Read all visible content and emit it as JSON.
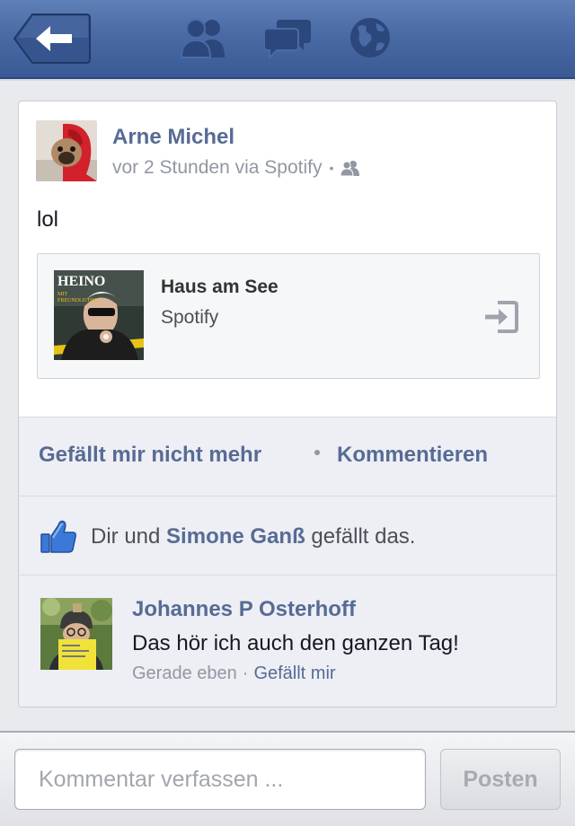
{
  "nav": {
    "icons": [
      "back-arrow-icon",
      "friends-icon",
      "messages-icon",
      "globe-icon"
    ]
  },
  "post": {
    "author": "Arne Michel",
    "time": "vor 2 Stunden via Spotify",
    "separator": "•",
    "audience_icon": "friends-audience-icon",
    "text": "lol",
    "attachment": {
      "title": "Haus am See",
      "source": "Spotify",
      "album_art_text": "HEINO",
      "open_icon": "open-external-icon"
    }
  },
  "actions": {
    "unlike_label": "Gefällt mir nicht mehr",
    "comment_label": "Kommentieren"
  },
  "likes": {
    "prefix": "Dir und ",
    "name": "Simone Ganß",
    "suffix": " gefällt das."
  },
  "comment": {
    "author": "Johannes P Osterhoff",
    "text": "Das hör ich auch den ganzen Tag!",
    "time": "Gerade eben",
    "separator": "·",
    "like_label": "Gefällt mir"
  },
  "composer": {
    "placeholder": "Kommentar verfassen ...",
    "post_label": "Posten"
  },
  "colors": {
    "navbar": "#4a6aa5",
    "link": "#576b95",
    "meta": "#9197a3",
    "like_blue": "#3b79d8"
  }
}
